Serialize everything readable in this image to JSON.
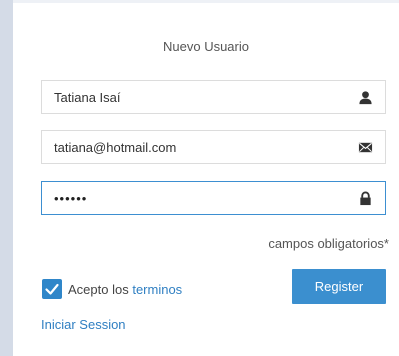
{
  "form": {
    "title": "Nuevo Usuario",
    "name_value": "Tatiana Isaí",
    "email_value": "tatiana@hotmail.com",
    "password_mask": "••••••",
    "required_note": "campos obligatorios*",
    "accept_prefix": "Acepto los",
    "accept_link": "terminos",
    "accept_checked": true,
    "register_label": "Register",
    "login_link": "Iniciar Session"
  },
  "icons": {
    "name": "user-icon",
    "email": "envelope-icon",
    "password": "lock-icon",
    "checkbox": "check-icon"
  },
  "colors": {
    "accent": "#3b8fcf",
    "link": "#2f7fc2",
    "focus_border": "#3d8fd1",
    "left_bar": "#d4dbe7"
  }
}
